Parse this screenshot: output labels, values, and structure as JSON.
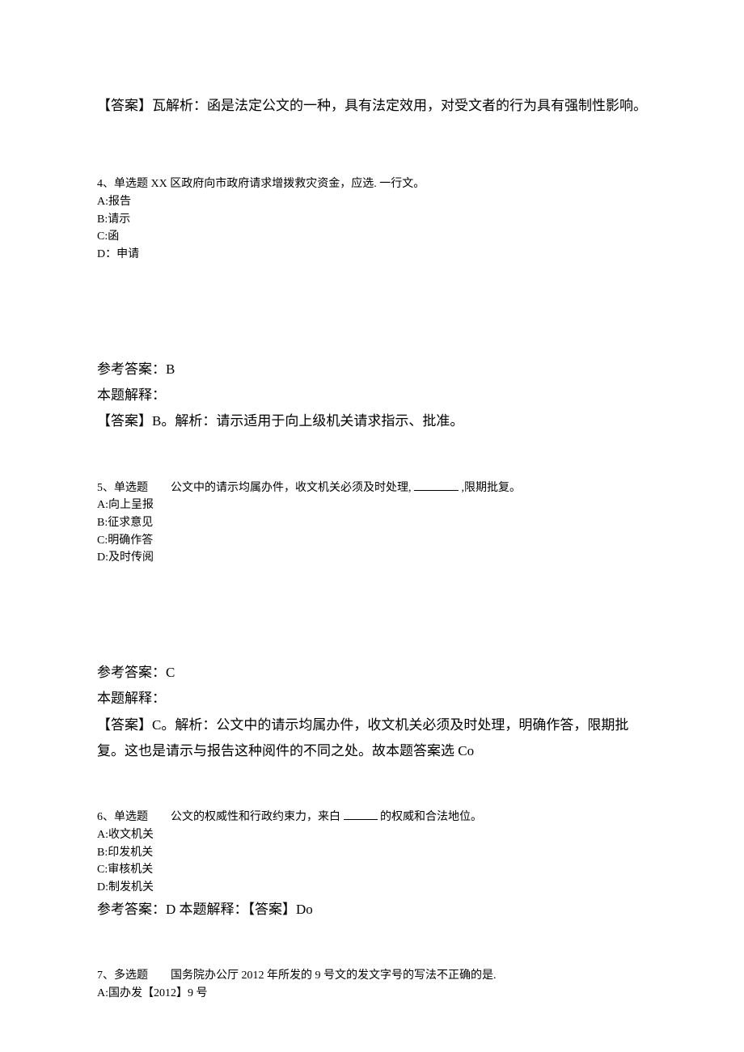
{
  "q3_answer_line": "【答案】瓦解析：函是法定公文的一种，具有法定效用，对受文者的行为具有强制性影响。",
  "q4": {
    "stem": "4、单选题 XX 区政府向市政府请求增拨救灾资金，应选. 一行文。",
    "opt_a": "A:报告",
    "opt_b": "B:请示",
    "opt_c": "C:函",
    "opt_d": "D：申请",
    "ref_label": "参考答案：B",
    "explain_label": "本题解释：",
    "explain_text": "【答案】B。解析：请示适用于向上级机关请求指示、批准。"
  },
  "q5": {
    "stem_prefix": "5、单选题　　公文中的请示均属办件，收文机关必须及时处理, ",
    "stem_suffix": " ,限期批复。",
    "opt_a": "A:向上呈报",
    "opt_b": "B:征求意见",
    "opt_c": "C:明确作答",
    "opt_d": "D:及时传阅",
    "ref_label": "参考答案：C",
    "explain_label": "本题解释：",
    "explain_text": "【答案】C。解析：公文中的请示均属办件，收文机关必须及时处理，明确作答，限期批复。这也是请示与报告这种阅件的不同之处。故本题答案选 Co"
  },
  "q6": {
    "stem_prefix": "6、单选题　　公文的权威性和行政约束力，来白 ",
    "stem_suffix": " 的权威和合法地位。",
    "opt_a": "A:收文机关",
    "opt_b": "B:印发机关",
    "opt_c": "C:审核机关",
    "opt_d": "D:制发机关",
    "ref_line": "参考答案：D 本题解释：【答案】Do"
  },
  "q7": {
    "stem": "7、多选题　　国务院办公厅 2012 年所发的 9 号文的发文字号的写法不正确的是.",
    "opt_a": "A:国办发【2012】9 号"
  }
}
